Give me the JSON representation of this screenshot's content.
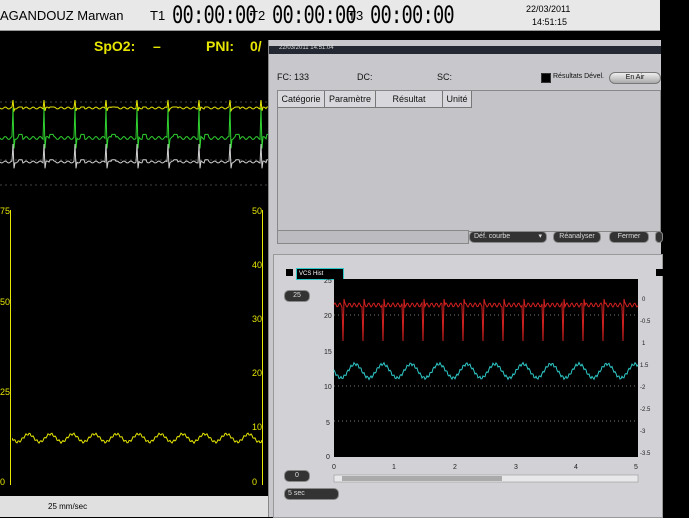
{
  "header": {
    "patient": "AGANDOUZ Marwan",
    "timers": [
      {
        "label": "T1",
        "value": "00:00:00"
      },
      {
        "label": "T2",
        "value": "00:00:00"
      },
      {
        "label": "T3",
        "value": "00:00:00"
      }
    ],
    "date": "22/03/2011",
    "time": "14:51:15"
  },
  "monitor": {
    "spo2_label": "SpO2:",
    "spo2_value": "–",
    "pni_label": "PNI:",
    "pni_value": "0/",
    "left_scale": [
      "75",
      "50",
      "25",
      "0"
    ],
    "right_scale": [
      "50",
      "40",
      "30",
      "20",
      "10",
      "0"
    ],
    "speed": "25 mm/sec"
  },
  "dialog": {
    "title_timestamp": "22/03/2011 14:51:04",
    "fc_label": "FC: 133",
    "dc_label": "DC:",
    "sc_label": "SC:",
    "results_checkbox_label": "Résultats Dével.",
    "en_air_button": "En Air",
    "table_headers": [
      "Catégorie",
      "Paramètre",
      "Résultat",
      "Unité"
    ],
    "dropdown_value": "Déf. courbe",
    "reanalyze_button": "Réanalyser",
    "close_button": "Fermer",
    "lower": {
      "vcs_label": "VCS Hist",
      "scale_select": "25",
      "small_select": "0",
      "duration_select": "5 sec",
      "y_ticks": [
        "25",
        "20",
        "15",
        "10",
        "5",
        "0"
      ],
      "x_ticks": [
        "0",
        "1",
        "2",
        "3",
        "4",
        "5"
      ],
      "right_ticks": [
        "0",
        "-0.5",
        "1",
        "1.5",
        "-2",
        "-2.5",
        "-3",
        "-3.5"
      ]
    }
  },
  "colors": {
    "yellow_wave": "#e6e600",
    "green_wave": "#2fd02f",
    "red_wave": "#d22020",
    "cyan_wave": "#2fc8c8"
  }
}
